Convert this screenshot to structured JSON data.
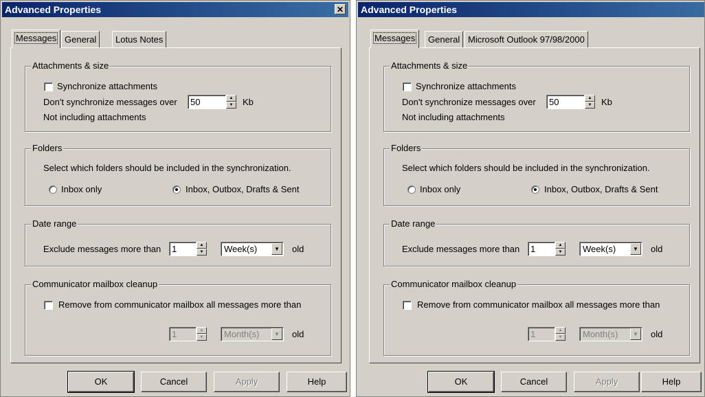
{
  "dialogs": [
    {
      "title": "Advanced Properties",
      "tabs": [
        "Messages",
        "General",
        "Lotus Notes"
      ],
      "attachments": {
        "legend": "Attachments & size",
        "sync_label": "Synchronize attachments",
        "dont_sync_label": "Don't synchronize messages over",
        "size_value": "50",
        "unit": "Kb",
        "note": "Not including attachments"
      },
      "folders": {
        "legend": "Folders",
        "instruction": "Select which folders should be included in the synchronization.",
        "option_inbox": "Inbox only",
        "option_all": "Inbox, Outbox, Drafts & Sent"
      },
      "date_range": {
        "legend": "Date range",
        "label": "Exclude messages more than",
        "value": "1",
        "unit": "Week(s)",
        "suffix": "old"
      },
      "cleanup": {
        "legend": "Communicator mailbox cleanup",
        "label": "Remove from communicator mailbox all messages more than",
        "value": "1",
        "unit": "Month(s)",
        "suffix": "old"
      },
      "buttons": {
        "ok": "OK",
        "cancel": "Cancel",
        "apply": "Apply",
        "help": "Help"
      }
    },
    {
      "title": "Advanced Properties",
      "tabs": [
        "Messages",
        "General",
        "Microsoft Outlook 97/98/2000"
      ],
      "attachments": {
        "legend": "Attachments & size",
        "sync_label": "Synchronize attachments",
        "dont_sync_label": "Don't synchronize messages over",
        "size_value": "50",
        "unit": "Kb",
        "note": "Not including attachments"
      },
      "folders": {
        "legend": "Folders",
        "instruction": "Select which folders should be included in the synchronization.",
        "option_inbox": "Inbox only",
        "option_all": "Inbox, Outbox, Drafts & Sent"
      },
      "date_range": {
        "legend": "Date range",
        "label": "Exclude messages more than",
        "value": "1",
        "unit": "Week(s)",
        "suffix": "old"
      },
      "cleanup": {
        "legend": "Communicator mailbox cleanup",
        "label": "Remove from communicator mailbox all messages more than",
        "value": "1",
        "unit": "Month(s)",
        "suffix": "old"
      },
      "buttons": {
        "ok": "OK",
        "cancel": "Cancel",
        "apply": "Apply",
        "help": "Help"
      }
    }
  ],
  "icons": {
    "close": "close-icon",
    "spin_up": "up-arrow-icon",
    "spin_down": "down-arrow-icon",
    "dropdown": "chevron-down-icon"
  },
  "colors": {
    "titlebar_start": "#0a246a",
    "titlebar_end": "#3a6ea5",
    "face": "#d4d0c8"
  }
}
